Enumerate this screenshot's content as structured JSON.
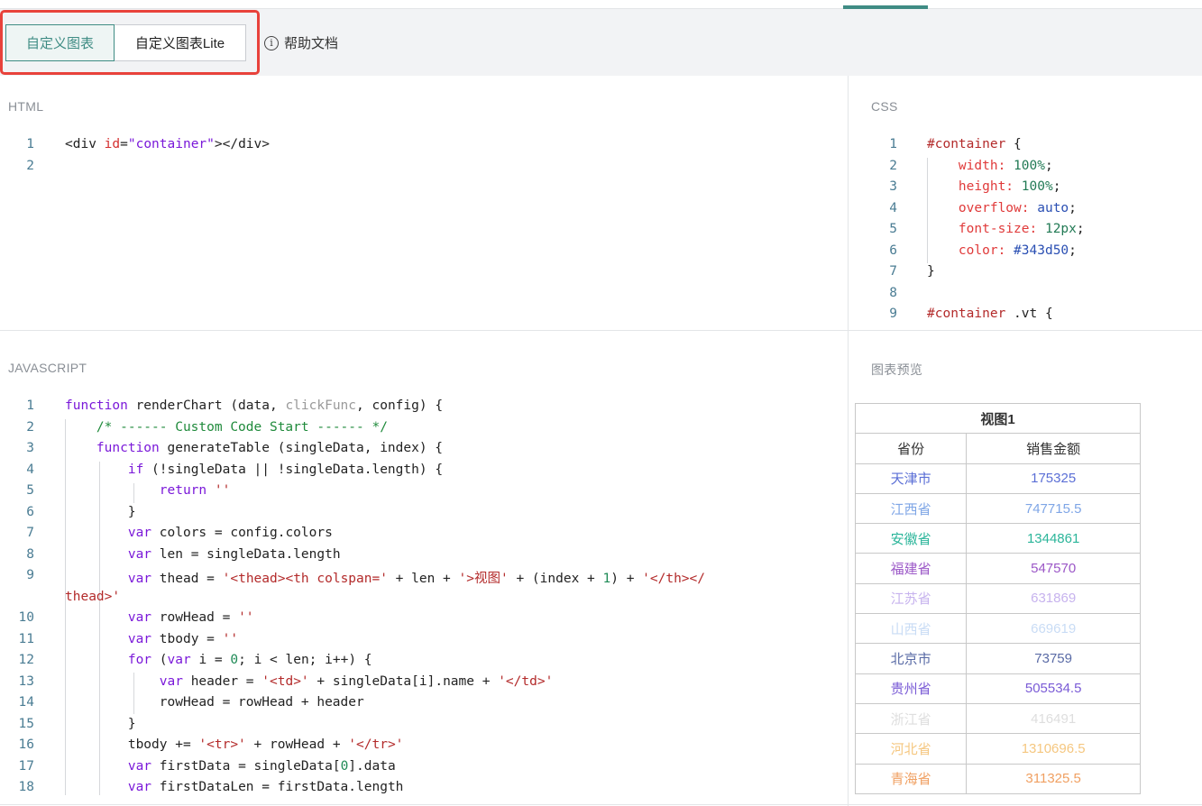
{
  "toolbar": {
    "tabs": [
      {
        "label": "自定义图表",
        "active": true
      },
      {
        "label": "自定义图表Lite",
        "active": false
      }
    ],
    "help_icon_glyph": "i",
    "help_label": "帮助文档",
    "accent_color": "#3f8c84",
    "highlight_color": "#e8423b"
  },
  "panels": {
    "html": {
      "title": "HTML",
      "line_numbers": [
        "1",
        "2"
      ]
    },
    "css": {
      "title": "CSS",
      "line_numbers": [
        "1",
        "2",
        "3",
        "4",
        "5",
        "6",
        "7",
        "8",
        "9"
      ]
    },
    "js": {
      "title": "JAVASCRIPT",
      "line_numbers": [
        "1",
        "2",
        "3",
        "4",
        "5",
        "6",
        "7",
        "8",
        "9",
        "10",
        "11",
        "12",
        "13",
        "14",
        "15",
        "16",
        "17",
        "18"
      ]
    },
    "preview": {
      "title": "图表预览"
    }
  },
  "code": {
    "html": [
      [
        [
          "t",
          "<div "
        ],
        [
          "attr",
          "id"
        ],
        [
          "t",
          "="
        ],
        [
          "kw",
          "\"container\""
        ],
        [
          "t",
          "></div>"
        ]
      ],
      []
    ],
    "css": [
      [
        [
          "str",
          "#container"
        ],
        [
          "t",
          " {"
        ]
      ],
      [
        [
          "t",
          "    "
        ],
        [
          "prop",
          "width:"
        ],
        [
          "t",
          " "
        ],
        [
          "val",
          "100%"
        ],
        [
          "t",
          ";"
        ]
      ],
      [
        [
          "t",
          "    "
        ],
        [
          "prop",
          "height:"
        ],
        [
          "t",
          " "
        ],
        [
          "val",
          "100%"
        ],
        [
          "t",
          ";"
        ]
      ],
      [
        [
          "t",
          "    "
        ],
        [
          "prop",
          "overflow:"
        ],
        [
          "t",
          " "
        ],
        [
          "hex",
          "auto"
        ],
        [
          "t",
          ";"
        ]
      ],
      [
        [
          "t",
          "    "
        ],
        [
          "prop",
          "font-size:"
        ],
        [
          "t",
          " "
        ],
        [
          "val",
          "12px"
        ],
        [
          "t",
          ";"
        ]
      ],
      [
        [
          "t",
          "    "
        ],
        [
          "prop",
          "color:"
        ],
        [
          "t",
          " "
        ],
        [
          "hex",
          "#343d50"
        ],
        [
          "t",
          ";"
        ]
      ],
      [
        [
          "t",
          "}"
        ]
      ],
      [],
      [
        [
          "str",
          "#container"
        ],
        [
          "t",
          " .vt {"
        ]
      ]
    ],
    "js": [
      [
        [
          "kw",
          "function"
        ],
        [
          "t",
          " renderChart (data, "
        ],
        [
          "faint",
          "clickFunc"
        ],
        [
          "t",
          ", config) {"
        ]
      ],
      [
        [
          "t",
          "    "
        ],
        [
          "cmt",
          "/* ------ Custom Code Start ------ */"
        ]
      ],
      [
        [
          "t",
          "    "
        ],
        [
          "kw",
          "function"
        ],
        [
          "t",
          " generateTable (singleData, index) {"
        ]
      ],
      [
        [
          "t",
          "        "
        ],
        [
          "kw",
          "if"
        ],
        [
          "t",
          " (!singleData || !singleData.length) {"
        ]
      ],
      [
        [
          "t",
          "            "
        ],
        [
          "kw",
          "return"
        ],
        [
          "t",
          " "
        ],
        [
          "str",
          "''"
        ]
      ],
      [
        [
          "t",
          "        }"
        ]
      ],
      [
        [
          "t",
          "        "
        ],
        [
          "kw",
          "var"
        ],
        [
          "t",
          " colors = config.colors"
        ]
      ],
      [
        [
          "t",
          "        "
        ],
        [
          "kw",
          "var"
        ],
        [
          "t",
          " len = singleData.length"
        ]
      ],
      [
        [
          "t",
          "        "
        ],
        [
          "kw",
          "var"
        ],
        [
          "t",
          " thead = "
        ],
        [
          "str",
          "'<thead><th colspan='"
        ],
        [
          "t",
          " + len + "
        ],
        [
          "str",
          "'>视图'"
        ],
        [
          "t",
          " + (index + "
        ],
        [
          "num",
          "1"
        ],
        [
          "t",
          ") + "
        ],
        [
          "str",
          "'</th></"
        ]
      ],
      [
        [
          "str",
          "thead>'"
        ]
      ],
      [
        [
          "t",
          "        "
        ],
        [
          "kw",
          "var"
        ],
        [
          "t",
          " rowHead = "
        ],
        [
          "str",
          "''"
        ]
      ],
      [
        [
          "t",
          "        "
        ],
        [
          "kw",
          "var"
        ],
        [
          "t",
          " tbody = "
        ],
        [
          "str",
          "''"
        ]
      ],
      [
        [
          "t",
          "        "
        ],
        [
          "kw",
          "for"
        ],
        [
          "t",
          " ("
        ],
        [
          "kw",
          "var"
        ],
        [
          "t",
          " i = "
        ],
        [
          "num",
          "0"
        ],
        [
          "t",
          "; i < len; i++) {"
        ]
      ],
      [
        [
          "t",
          "            "
        ],
        [
          "kw",
          "var"
        ],
        [
          "t",
          " header = "
        ],
        [
          "str",
          "'<td>'"
        ],
        [
          "t",
          " + singleData[i].name + "
        ],
        [
          "str",
          "'</td>'"
        ]
      ],
      [
        [
          "t",
          "            rowHead = rowHead + header"
        ]
      ],
      [
        [
          "t",
          "        }"
        ]
      ],
      [
        [
          "t",
          "        tbody += "
        ],
        [
          "str",
          "'<tr>'"
        ],
        [
          "t",
          " + rowHead + "
        ],
        [
          "str",
          "'</tr>'"
        ]
      ],
      [
        [
          "t",
          "        "
        ],
        [
          "kw",
          "var"
        ],
        [
          "t",
          " firstData = singleData["
        ],
        [
          "num",
          "0"
        ],
        [
          "t",
          "].data"
        ]
      ],
      [
        [
          "t",
          "        "
        ],
        [
          "kw",
          "var"
        ],
        [
          "t",
          " firstDataLen = firstData.length"
        ]
      ]
    ]
  },
  "preview_table": {
    "title": "视图1",
    "headers": [
      "省份",
      "销售金额"
    ],
    "rows": [
      {
        "name": "天津市",
        "value": "175325",
        "color": "#5b6fd6"
      },
      {
        "name": "江西省",
        "value": "747715.5",
        "color": "#7fa6e6"
      },
      {
        "name": "安徽省",
        "value": "1344861",
        "color": "#2bb59a"
      },
      {
        "name": "福建省",
        "value": "547570",
        "color": "#9b57c7"
      },
      {
        "name": "江苏省",
        "value": "631869",
        "color": "#c7b3ee"
      },
      {
        "name": "山西省",
        "value": "669619",
        "color": "#c9dcf5"
      },
      {
        "name": "北京市",
        "value": "73759",
        "color": "#5a6ba6"
      },
      {
        "name": "贵州省",
        "value": "505534.5",
        "color": "#7a5bd6"
      },
      {
        "name": "浙江省",
        "value": "416491",
        "color": "#dedede"
      },
      {
        "name": "河北省",
        "value": "1310696.5",
        "color": "#f5c780"
      },
      {
        "name": "青海省",
        "value": "311325.5",
        "color": "#f0a062"
      }
    ]
  }
}
